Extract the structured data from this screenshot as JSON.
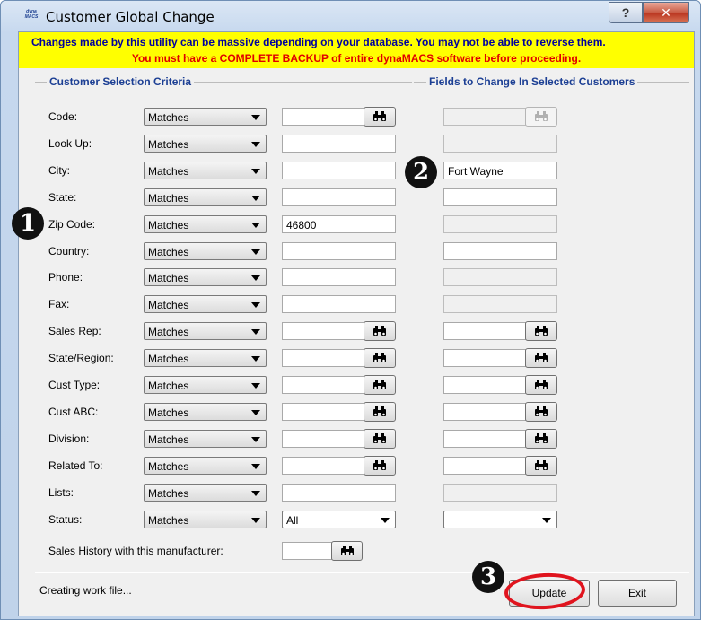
{
  "window": {
    "title": "Customer Global Change",
    "logo_text": "dyna MACS",
    "help_label": "?",
    "close_label": "✕"
  },
  "warning": {
    "line1": "Changes made by this utility can be massive depending on your database. You may not be able to reverse them.",
    "line2": "You must have a COMPLETE BACKUP of entire dynaMACS software before proceeding."
  },
  "groups": {
    "selection_title": "Customer Selection Criteria",
    "change_title": "Fields to Change In Selected Customers"
  },
  "rows": [
    {
      "label": "Code:",
      "operator": "Matches",
      "value": "",
      "change": ""
    },
    {
      "label": "Look Up:",
      "operator": "Matches",
      "value": "",
      "change": ""
    },
    {
      "label": "City:",
      "operator": "Matches",
      "value": "",
      "change": "Fort Wayne"
    },
    {
      "label": "State:",
      "operator": "Matches",
      "value": "",
      "change": ""
    },
    {
      "label": "Zip Code:",
      "operator": "Matches",
      "value": "46800",
      "change": ""
    },
    {
      "label": "Country:",
      "operator": "Matches",
      "value": "",
      "change": ""
    },
    {
      "label": "Phone:",
      "operator": "Matches",
      "value": "",
      "change": ""
    },
    {
      "label": "Fax:",
      "operator": "Matches",
      "value": "",
      "change": ""
    },
    {
      "label": "Sales Rep:",
      "operator": "Matches",
      "value": "",
      "change": ""
    },
    {
      "label": "State/Region:",
      "operator": "Matches",
      "value": "",
      "change": ""
    },
    {
      "label": "Cust Type:",
      "operator": "Matches",
      "value": "",
      "change": ""
    },
    {
      "label": "Cust ABC:",
      "operator": "Matches",
      "value": "",
      "change": ""
    },
    {
      "label": "Division:",
      "operator": "Matches",
      "value": "",
      "change": ""
    },
    {
      "label": "Related To:",
      "operator": "Matches",
      "value": "",
      "change": ""
    },
    {
      "label": "Lists:",
      "operator": "Matches",
      "value": "",
      "change": ""
    },
    {
      "label": "Status:",
      "operator": "Matches",
      "value": "All",
      "change": ""
    }
  ],
  "sales_history": {
    "label": "Sales History with this manufacturer:",
    "value": ""
  },
  "status_text": "Creating work file...",
  "buttons": {
    "update_label": "Update",
    "exit_label": "Exit"
  },
  "markers": {
    "one": "1",
    "two": "2",
    "three": "3"
  },
  "icons": {
    "lookup": "binoculars-icon"
  },
  "colors": {
    "warning_bg": "#ffff00",
    "warning_line1": "#0000a0",
    "warning_line2": "#e00000",
    "group_title": "#1c3f94",
    "highlight_ring": "#e0141e"
  }
}
